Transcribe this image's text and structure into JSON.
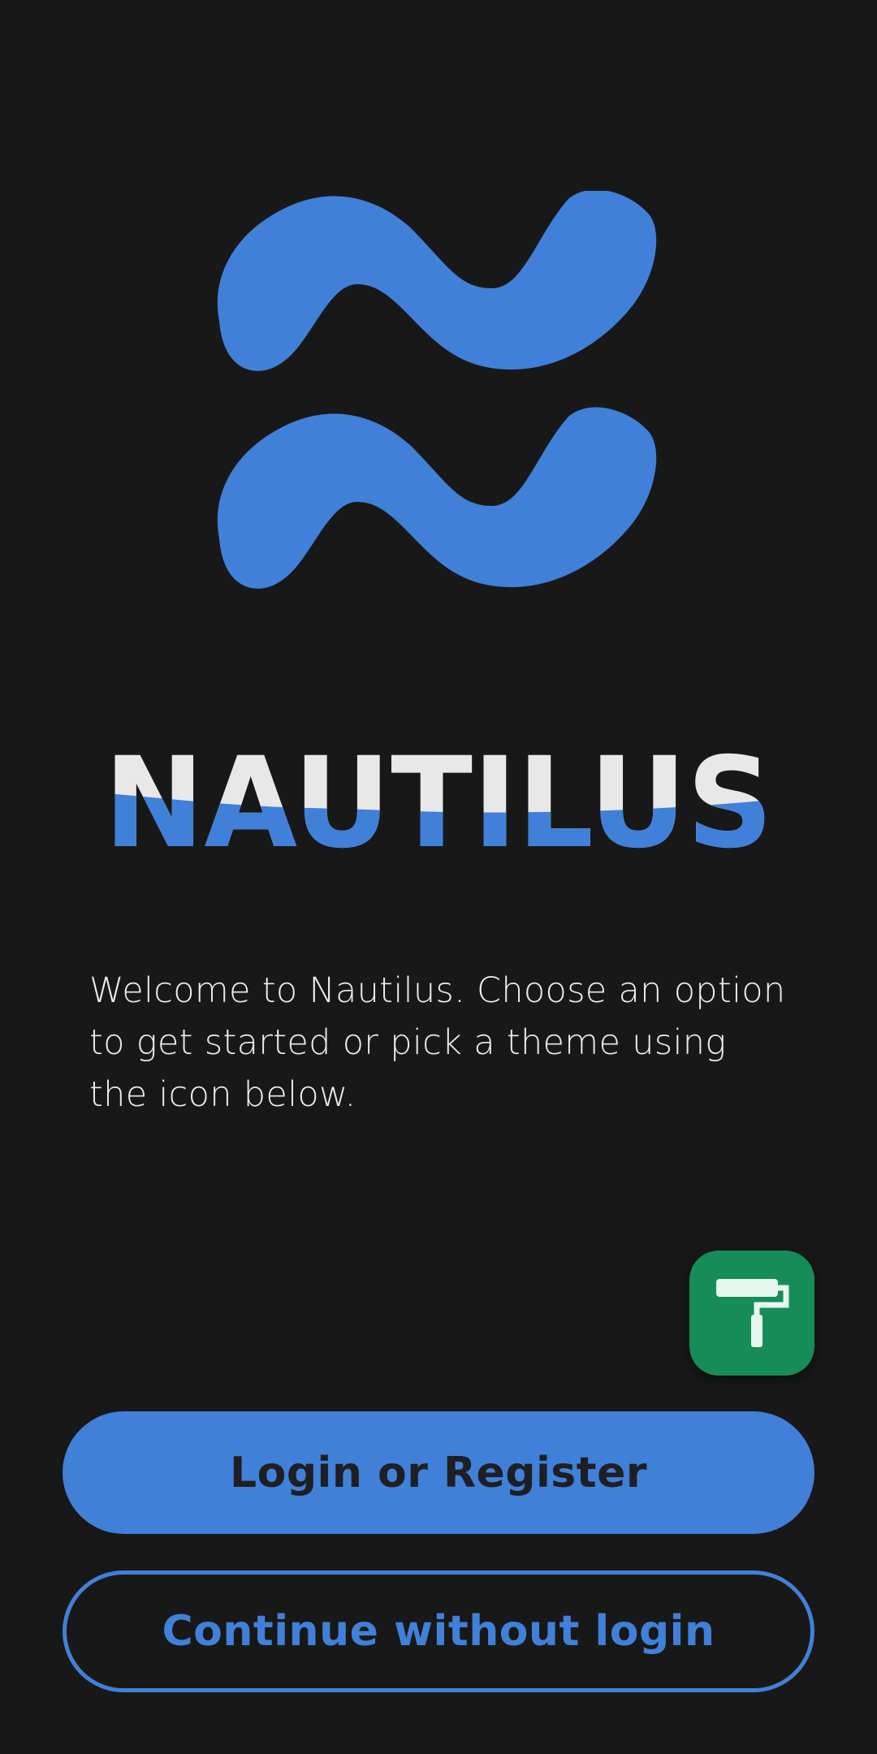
{
  "app": {
    "name": "NAUTILUS",
    "logo_icon": "nautilus-wave-logo-icon"
  },
  "welcome": {
    "text": "Welcome to Nautilus. Choose an option to get started or pick a theme using the icon below."
  },
  "theme_button": {
    "icon": "paint-roller-icon"
  },
  "actions": {
    "login_label": "Login or Register",
    "guest_label": "Continue without login"
  },
  "colors": {
    "background": "#181818",
    "accent": "#4080d8",
    "wordmark_light": "#e8e8e8",
    "theme_button": "#168c58",
    "primary_button_text": "#1e1f23",
    "body_text": "#ececec"
  }
}
